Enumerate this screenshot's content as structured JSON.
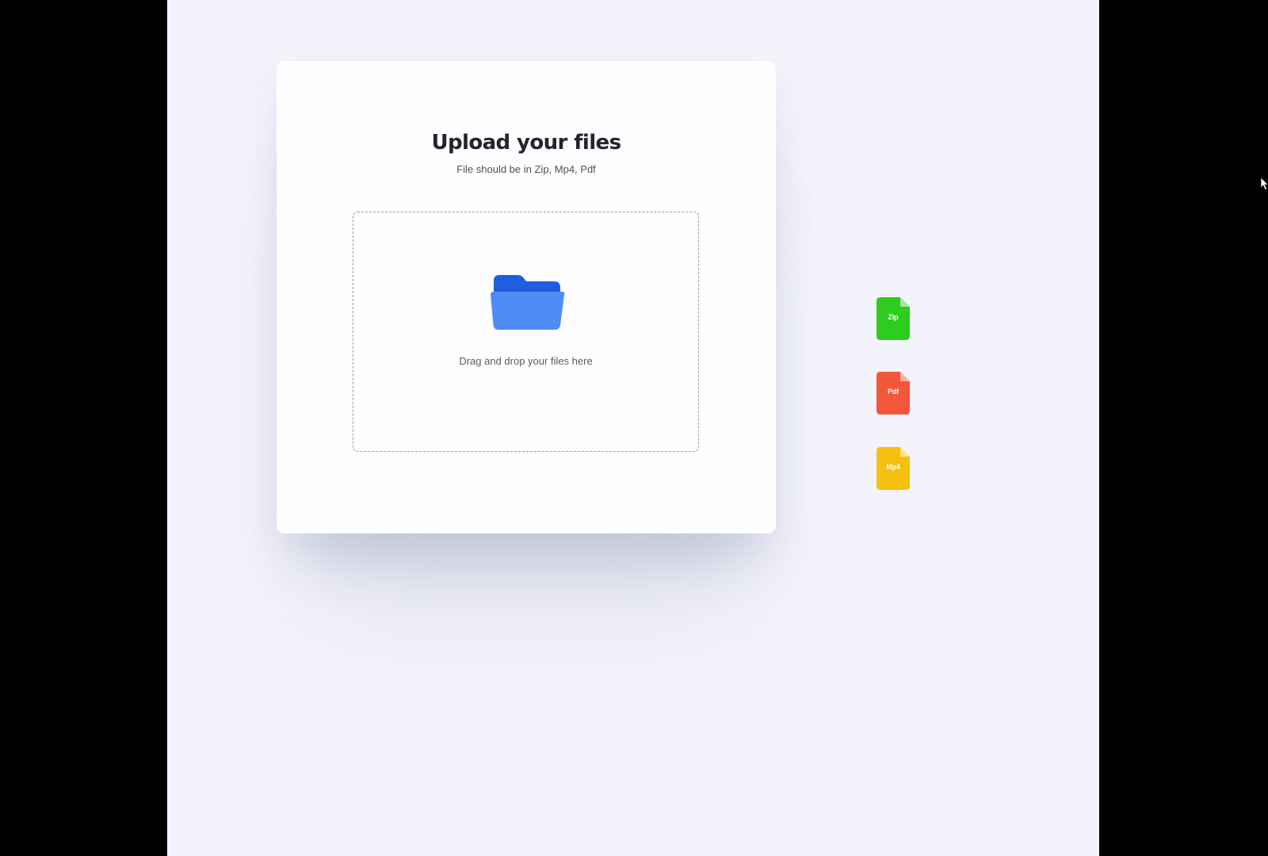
{
  "upload_card": {
    "title": "Upload your files",
    "subtitle": "File should be in Zip, Mp4, Pdf",
    "dropzone": {
      "icon": "folder-icon",
      "text": "Drag and drop your files here"
    }
  },
  "file_types": [
    {
      "label": "Zip",
      "icon": "file-icon",
      "color": "#2ecc1f"
    },
    {
      "label": "Pdf",
      "icon": "file-icon",
      "color": "#f4563a"
    },
    {
      "label": "Mp4",
      "icon": "file-icon",
      "color": "#f5c00f"
    }
  ],
  "colors": {
    "folder_back": "#1d5fe0",
    "folder_front": "#4f8cf7",
    "page_background": "#f3f3fb",
    "outer_background": "#000000"
  }
}
